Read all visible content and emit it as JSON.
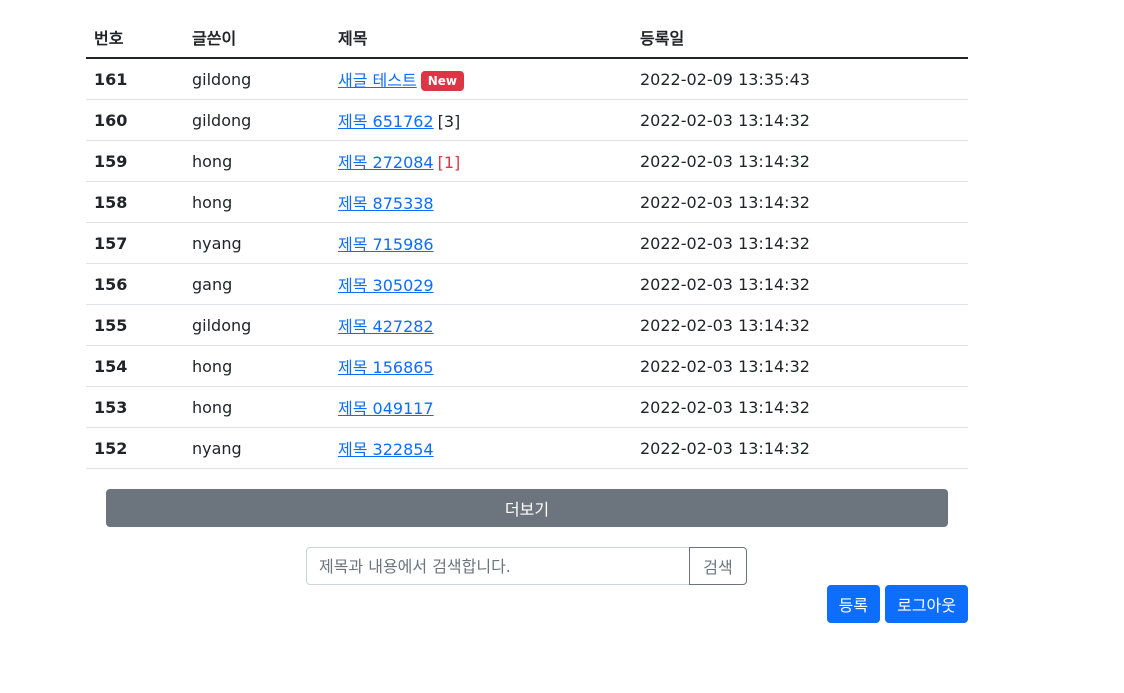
{
  "table": {
    "headers": {
      "no": "번호",
      "writer": "글쓴이",
      "title": "제목",
      "date": "등록일"
    },
    "rows": [
      {
        "no": "161",
        "writer": "gildong",
        "title": "새글 테스트",
        "badge": "New",
        "comment_count": "",
        "date": "2022-02-09 13:35:43"
      },
      {
        "no": "160",
        "writer": "gildong",
        "title": "제목 651762",
        "badge": "",
        "comment_count": "[3]",
        "date": "2022-02-03 13:14:32"
      },
      {
        "no": "159",
        "writer": "hong",
        "title": "제목 272084",
        "badge": "",
        "comment_count": "[1]",
        "date": "2022-02-03 13:14:32"
      },
      {
        "no": "158",
        "writer": "hong",
        "title": "제목 875338",
        "badge": "",
        "comment_count": "",
        "date": "2022-02-03 13:14:32"
      },
      {
        "no": "157",
        "writer": "nyang",
        "title": "제목 715986",
        "badge": "",
        "comment_count": "",
        "date": "2022-02-03 13:14:32"
      },
      {
        "no": "156",
        "writer": "gang",
        "title": "제목 305029",
        "badge": "",
        "comment_count": "",
        "date": "2022-02-03 13:14:32"
      },
      {
        "no": "155",
        "writer": "gildong",
        "title": "제목 427282",
        "badge": "",
        "comment_count": "",
        "date": "2022-02-03 13:14:32"
      },
      {
        "no": "154",
        "writer": "hong",
        "title": "제목 156865",
        "badge": "",
        "comment_count": "",
        "date": "2022-02-03 13:14:32"
      },
      {
        "no": "153",
        "writer": "hong",
        "title": "제목 049117",
        "badge": "",
        "comment_count": "",
        "date": "2022-02-03 13:14:32"
      },
      {
        "no": "152",
        "writer": "nyang",
        "title": "제목 322854",
        "badge": "",
        "comment_count": "",
        "date": "2022-02-03 13:14:32"
      }
    ]
  },
  "more_button": "더보기",
  "search": {
    "placeholder": "제목과 내용에서 검색합니다.",
    "value": "",
    "button": "검색"
  },
  "actions": {
    "register": "등록",
    "logout": "로그아웃"
  },
  "colors": {
    "link": "#0d6efd",
    "badge_new": "#dc3545",
    "comment_highlight": "#dc3545",
    "more_button": "#6c757d",
    "primary": "#0d6efd"
  }
}
